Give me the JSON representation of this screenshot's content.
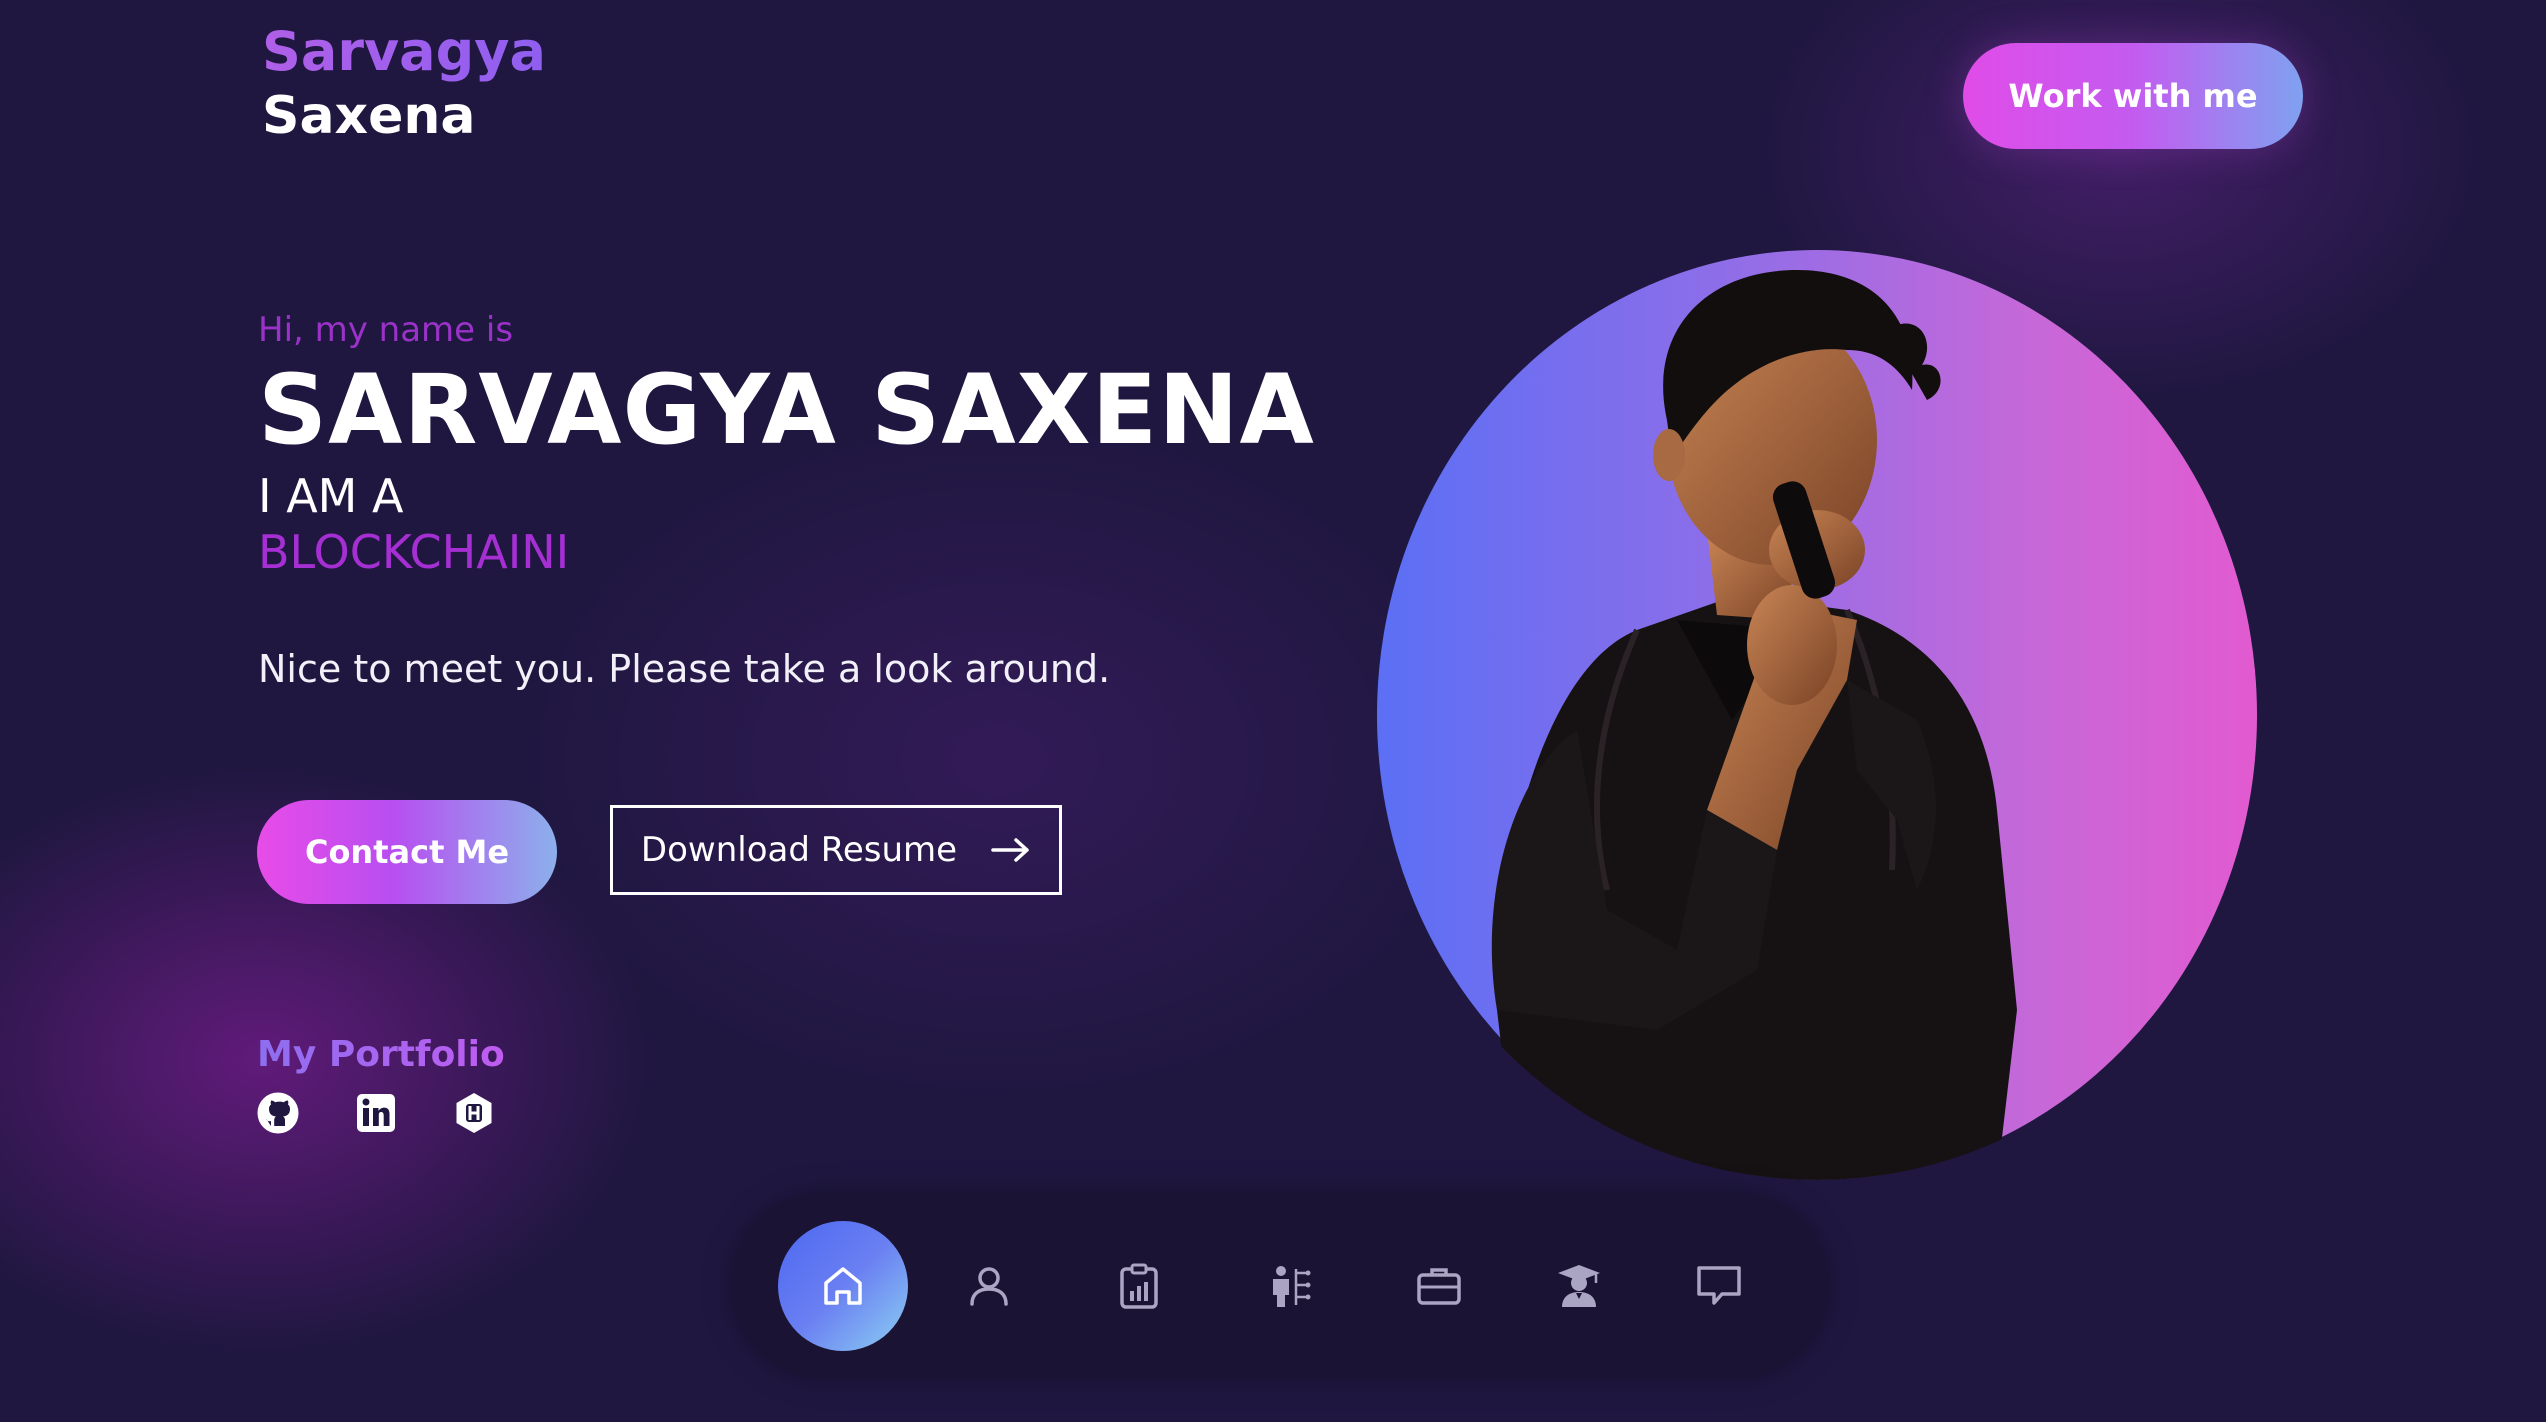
{
  "header": {
    "logo_first": "Sarvagya",
    "logo_last": "Saxena",
    "cta_label": "Work with me"
  },
  "hero": {
    "greeting": "Hi, my name is",
    "name": "SARVAGYA SAXENA",
    "i_am": "I AM A",
    "role": "BLOCKCHAINI",
    "intro": "Nice to meet you. Please take a look around."
  },
  "actions": {
    "contact_label": "Contact Me",
    "resume_label": "Download Resume"
  },
  "portfolio": {
    "title": "My Portfolio",
    "links": [
      "github-icon",
      "linkedin-icon",
      "hashnode-icon"
    ]
  },
  "nav": {
    "items": [
      "home-icon",
      "user-icon",
      "clipboard-chart-icon",
      "skills-icon",
      "briefcase-icon",
      "graduate-icon",
      "chat-icon"
    ],
    "active": "home-icon"
  },
  "colors": {
    "background": "#1f1740",
    "accent_pink": "#e04ce8",
    "accent_purple": "#a52fd2",
    "accent_blue": "#5b6ff5"
  }
}
